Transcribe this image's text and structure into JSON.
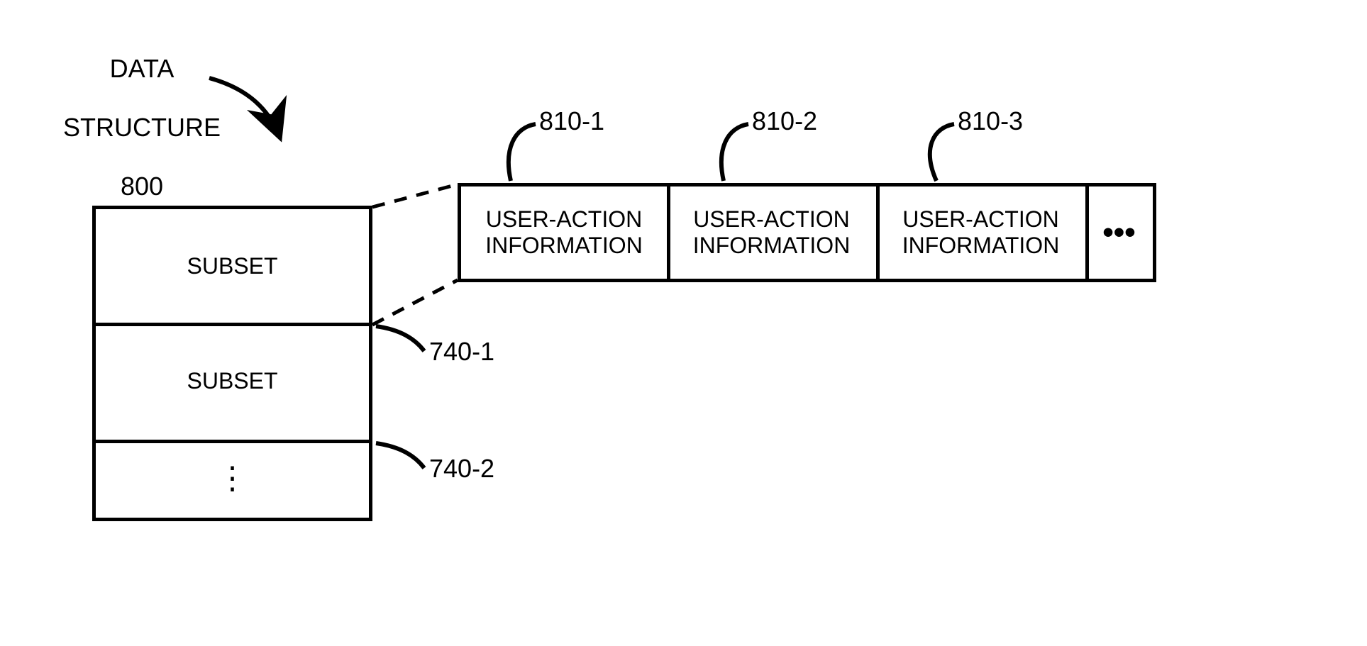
{
  "title": {
    "line1": "DATA",
    "line2": "STRUCTURE",
    "line3": "800"
  },
  "subsets": {
    "row1": "SUBSET",
    "row2": "SUBSET",
    "ref1": "740-1",
    "ref2": "740-2"
  },
  "user_actions": {
    "label": "USER-ACTION\nINFORMATION",
    "ref1": "810-1",
    "ref2": "810-2",
    "ref3": "810-3",
    "more": "•••"
  },
  "more_rows": "⋮"
}
